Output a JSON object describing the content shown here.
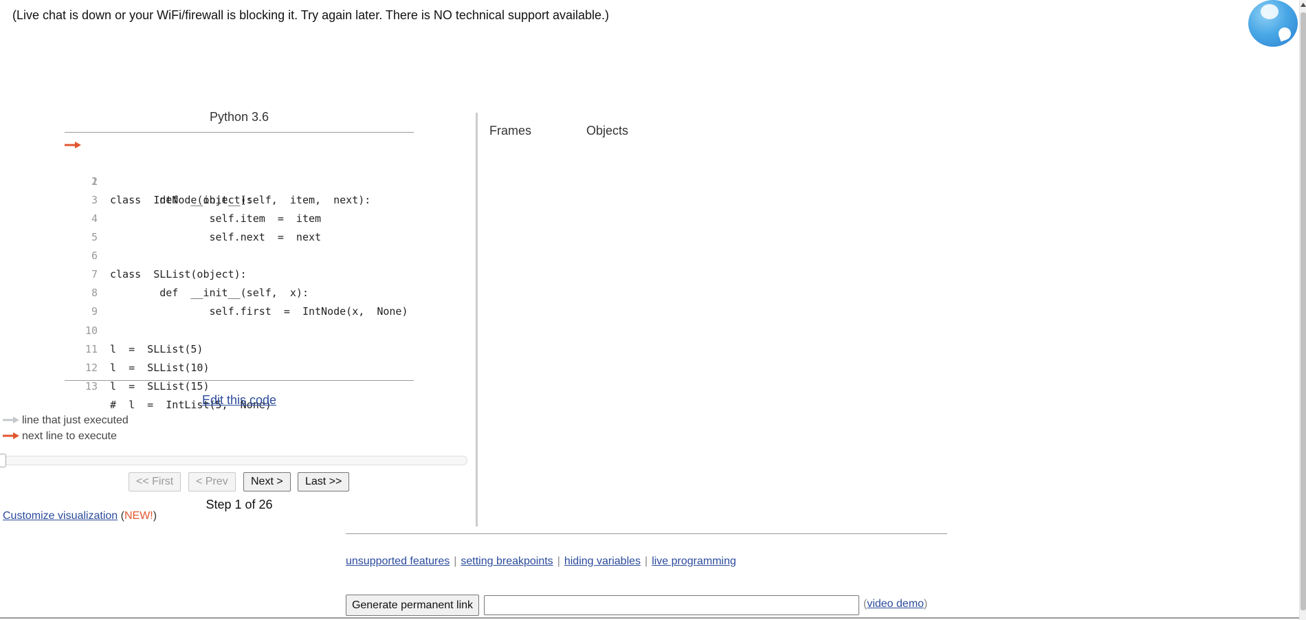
{
  "notice": "(Live chat is down or your WiFi/firewall is blocking it. Try again later. There is NO technical support available.)",
  "code_panel": {
    "language": "Python 3.6",
    "lines": [
      {
        "n": "1",
        "code": "class  IntNode(object):"
      },
      {
        "n": "2",
        "code": "        def  __init__(self,  item,  next):"
      },
      {
        "n": "3",
        "code": "                self.item  =  item"
      },
      {
        "n": "4",
        "code": "                self.next  =  next"
      },
      {
        "n": "5",
        "code": ""
      },
      {
        "n": "6",
        "code": "class  SLList(object):"
      },
      {
        "n": "7",
        "code": "        def  __init__(self,  x):"
      },
      {
        "n": "8",
        "code": "                self.first  =  IntNode(x,  None)"
      },
      {
        "n": "9",
        "code": ""
      },
      {
        "n": "10",
        "code": "l  =  SLList(5)"
      },
      {
        "n": "11",
        "code": "l  =  SLList(10)"
      },
      {
        "n": "12",
        "code": "l  =  SLList(15)"
      },
      {
        "n": "13",
        "code": "#  l  =  IntList(5,  None)"
      }
    ],
    "edit_link": "Edit this code"
  },
  "legend": {
    "just_executed": "line that just executed",
    "next_to_execute": "next line to execute"
  },
  "navigation": {
    "first": "<< First",
    "prev": "< Prev",
    "next": "Next >",
    "last": "Last >>",
    "step_text": "Step 1 of 26",
    "progress": 0.0385
  },
  "customize": {
    "link": "Customize visualization",
    "open_paren": "(",
    "new_badge": "NEW!",
    "close_paren": ")"
  },
  "viz_panel": {
    "frames": "Frames",
    "objects": "Objects"
  },
  "footer": {
    "links": [
      "unsupported features",
      "setting breakpoints",
      "hiding variables",
      "live programming"
    ],
    "separator": "|",
    "permalink_button": "Generate permanent link",
    "permalink_value": "",
    "demo_open": "(",
    "demo_link": "video demo",
    "demo_close": ")"
  },
  "colors": {
    "next_arrow": "#e2552f",
    "prev_arrow": "#c5c9cc",
    "link": "#2a4a9b"
  },
  "icons": {
    "chat": "chat-bubble-icon",
    "next_line": "red-arrow-icon",
    "prev_line": "gray-arrow-icon"
  }
}
